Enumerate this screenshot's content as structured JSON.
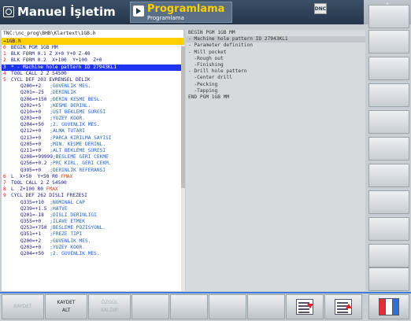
{
  "header": {
    "mode1_label": "Manuel İşletim",
    "mode2_title": "Programlama",
    "mode2_sub": "Programlama",
    "dnc_label": "DNC",
    "clock_symbol": "¢"
  },
  "program": {
    "path": "TNC:\\nc_prog\\BHB\\Klartext\\1GB.h",
    "file": "→1GB.h",
    "lines": [
      {
        "n": "0",
        "code": "BEGIN PGM 1GB MM",
        "comment": ""
      },
      {
        "n": "1",
        "code": "BLK FORM 0.1 Z X+0 Y+0 Z-40",
        "comment": ""
      },
      {
        "n": "2",
        "code": "BLK FORM 0.2  X+100  Y+100  Z+0",
        "comment": ""
      },
      {
        "n": "3",
        "code": "* - Machine hole pattern ID 27943KL1",
        "comment": "",
        "sel": true
      },
      {
        "n": "4",
        "code": "TOOL CALL 2 Z S4500",
        "comment": ""
      },
      {
        "n": "5",
        "code": "CYCL DEF 203 EVRENSEL DELIK",
        "comment": ""
      },
      {
        "n": "",
        "code": "Q200=+2   ",
        "comment": ";GUVENLIK MES."
      },
      {
        "n": "",
        "code": "Q201=-25  ",
        "comment": ";DERINLIK"
      },
      {
        "n": "",
        "code": "Q206=+150 ",
        "comment": ";DERIN KESME BESL."
      },
      {
        "n": "",
        "code": "Q202=+5   ",
        "comment": ";KESME DERINL."
      },
      {
        "n": "",
        "code": "Q210=+0   ",
        "comment": ";UST BEKLEME SURESI"
      },
      {
        "n": "",
        "code": "Q203=+0   ",
        "comment": ";YUZEY KOOR."
      },
      {
        "n": "",
        "code": "Q204=+50  ",
        "comment": ";2. GUVENLIK MES."
      },
      {
        "n": "",
        "code": "Q212=+0   ",
        "comment": ";ALMA TUTARI"
      },
      {
        "n": "",
        "code": "Q213=+0   ",
        "comment": ";PARCA KIRILMA SAYISI"
      },
      {
        "n": "",
        "code": "Q205=+0   ",
        "comment": ";MIN. KESME DERINL."
      },
      {
        "n": "",
        "code": "Q211=+0   ",
        "comment": ";ALT BEKLEME SURESI"
      },
      {
        "n": "",
        "code": "Q208=+99999",
        "comment": ";BESLEME GERI CEKME"
      },
      {
        "n": "",
        "code": "Q256=+0.2 ",
        "comment": ";PRC KIRL. GERI CEKM."
      },
      {
        "n": "",
        "code": "Q395=+0   ",
        "comment": ";DERINLIK REFERANSI"
      },
      {
        "n": "6",
        "code": "L  X+50  Y+50 R0 ",
        "comment": "",
        "hl": "FMAX"
      },
      {
        "n": "7",
        "code": "TOOL CALL 2 Z S4500",
        "comment": ""
      },
      {
        "n": "8",
        "code": "L  Z+100 R0 ",
        "comment": "",
        "hl": "FMAX"
      },
      {
        "n": "9",
        "code": "CYCL DEF 262 DISLI FREZESI",
        "comment": ""
      },
      {
        "n": "",
        "code": "Q335=+10  ",
        "comment": ";NOMINAL CAP"
      },
      {
        "n": "",
        "code": "Q239=+1.5 ",
        "comment": ";HATVE"
      },
      {
        "n": "",
        "code": "Q201=-18  ",
        "comment": ";DISLI DERINLIGI"
      },
      {
        "n": "",
        "code": "Q355=+0   ",
        "comment": ";ILAVE ETMEK"
      },
      {
        "n": "",
        "code": "Q253=+750 ",
        "comment": ";BESLEME POZISYONL."
      },
      {
        "n": "",
        "code": "Q351=+1   ",
        "comment": ";FREZE TIPI"
      },
      {
        "n": "",
        "code": "Q200=+2   ",
        "comment": ";GUVENLIK MES."
      },
      {
        "n": "",
        "code": "Q203=+0   ",
        "comment": ";YUZEY KOOR."
      },
      {
        "n": "",
        "code": "Q204=+50  ",
        "comment": ";2. GUVENLIK MES."
      }
    ]
  },
  "structure": {
    "lines": [
      {
        "text": "BEGIN PGM 1GB MM",
        "sel": false
      },
      {
        "text": "- Machine hole pattern ID 27943KL1",
        "sel": true
      },
      {
        "text": "- Parameter definition",
        "sel": false
      },
      {
        "text": "- Mill pocket",
        "sel": false
      },
      {
        "text": "  -Rough out",
        "sel": false
      },
      {
        "text": "  -Finishing",
        "sel": false
      },
      {
        "text": "- Drill hole pattern",
        "sel": false
      },
      {
        "text": "  -Center drill",
        "sel": false
      },
      {
        "text": "  -Pecking",
        "sel": false
      },
      {
        "text": "  -Tapping",
        "sel": false
      },
      {
        "text": "END PGM 1GB MM",
        "sel": false
      }
    ]
  },
  "softkeys": {
    "kaydet_label": "KAYDET",
    "kaydet_alt_line1": "KAYDET",
    "kaydet_alt_line2": "ALT",
    "ozgul_line1": "ÖZGÜL",
    "ozgul_line2": "KALDIR"
  },
  "icons": {
    "page_down": "page-down-icon",
    "page_up": "page-up-icon",
    "split_screen": "split-screen-icon"
  }
}
